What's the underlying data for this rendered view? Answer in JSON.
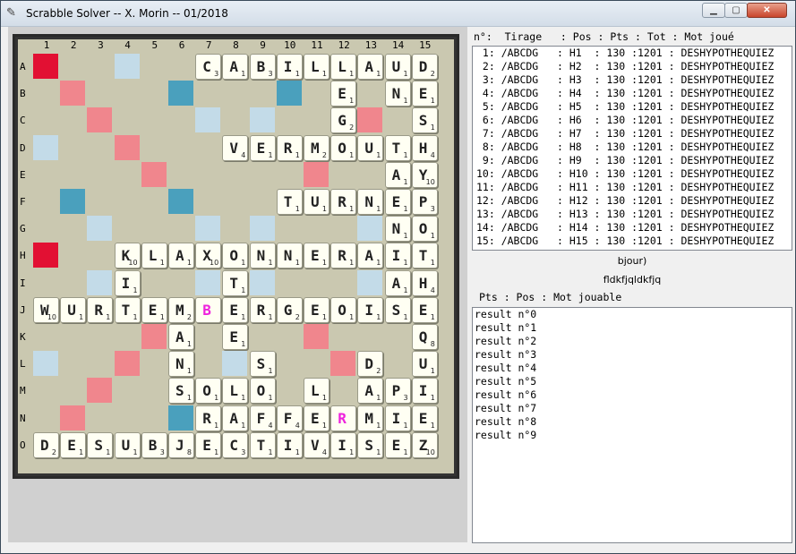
{
  "window": {
    "title": "Scrabble Solver -- X. Morin -- 01/2018"
  },
  "board": {
    "columns": [
      "1",
      "2",
      "3",
      "4",
      "5",
      "6",
      "7",
      "8",
      "9",
      "10",
      "11",
      "12",
      "13",
      "14",
      "15"
    ],
    "rows": [
      "A",
      "B",
      "C",
      "D",
      "E",
      "F",
      "G",
      "H",
      "I",
      "J",
      "K",
      "L",
      "M",
      "N",
      "O"
    ],
    "premium_map": [
      "T..d...........",
      ".d...l...l.....",
      "..d...d.d...d..",
      "d..d...........",
      "....d.....d....",
      ".l...l.........",
      "..d...d.d...d..",
      "T..............",
      "..d...d.d...d..",
      "...............",
      "....d.....d....",
      "d..d...d...d...",
      "..d...d.d...d..",
      ".d...l.........",
      "..............."
    ],
    "tiles": [
      [
        "A",
        7,
        "C",
        "3"
      ],
      [
        "A",
        8,
        "A",
        "1"
      ],
      [
        "A",
        9,
        "B",
        "3"
      ],
      [
        "A",
        10,
        "I",
        "1"
      ],
      [
        "A",
        11,
        "L",
        "1"
      ],
      [
        "A",
        12,
        "L",
        "1"
      ],
      [
        "A",
        13,
        "A",
        "1"
      ],
      [
        "A",
        14,
        "U",
        "1"
      ],
      [
        "A",
        15,
        "D",
        "2"
      ],
      [
        "B",
        12,
        "E",
        "1"
      ],
      [
        "B",
        14,
        "N",
        "1"
      ],
      [
        "B",
        15,
        "E",
        "1"
      ],
      [
        "C",
        12,
        "G",
        "2"
      ],
      [
        "C",
        15,
        "S",
        "1"
      ],
      [
        "D",
        8,
        "V",
        "4"
      ],
      [
        "D",
        9,
        "E",
        "1"
      ],
      [
        "D",
        10,
        "R",
        "1"
      ],
      [
        "D",
        11,
        "M",
        "2"
      ],
      [
        "D",
        12,
        "O",
        "1"
      ],
      [
        "D",
        13,
        "U",
        "1"
      ],
      [
        "D",
        14,
        "T",
        "1"
      ],
      [
        "D",
        15,
        "H",
        "4"
      ],
      [
        "E",
        14,
        "A",
        "1"
      ],
      [
        "E",
        15,
        "Y",
        "10"
      ],
      [
        "F",
        10,
        "T",
        "1"
      ],
      [
        "F",
        11,
        "U",
        "1"
      ],
      [
        "F",
        12,
        "R",
        "1"
      ],
      [
        "F",
        13,
        "N",
        "1"
      ],
      [
        "F",
        14,
        "E",
        "1"
      ],
      [
        "F",
        15,
        "P",
        "3"
      ],
      [
        "G",
        14,
        "N",
        "1"
      ],
      [
        "G",
        15,
        "O",
        "1"
      ],
      [
        "H",
        4,
        "K",
        "10"
      ],
      [
        "H",
        5,
        "L",
        "1"
      ],
      [
        "H",
        6,
        "A",
        "1"
      ],
      [
        "H",
        7,
        "X",
        "10"
      ],
      [
        "H",
        8,
        "O",
        "1"
      ],
      [
        "H",
        9,
        "N",
        "1"
      ],
      [
        "H",
        10,
        "N",
        "1"
      ],
      [
        "H",
        11,
        "E",
        "1"
      ],
      [
        "H",
        12,
        "R",
        "1"
      ],
      [
        "H",
        13,
        "A",
        "1"
      ],
      [
        "H",
        14,
        "I",
        "1"
      ],
      [
        "H",
        15,
        "T",
        "1"
      ],
      [
        "I",
        4,
        "I",
        "1"
      ],
      [
        "I",
        8,
        "T",
        "1"
      ],
      [
        "I",
        14,
        "A",
        "1"
      ],
      [
        "I",
        15,
        "H",
        "4"
      ],
      [
        "J",
        1,
        "W",
        "10"
      ],
      [
        "J",
        2,
        "U",
        "1"
      ],
      [
        "J",
        3,
        "R",
        "1"
      ],
      [
        "J",
        4,
        "T",
        "1"
      ],
      [
        "J",
        5,
        "E",
        "1"
      ],
      [
        "J",
        6,
        "M",
        "2"
      ],
      [
        "J",
        7,
        "B",
        "*"
      ],
      [
        "J",
        8,
        "E",
        "1"
      ],
      [
        "J",
        9,
        "R",
        "1"
      ],
      [
        "J",
        10,
        "G",
        "2"
      ],
      [
        "J",
        11,
        "E",
        "1"
      ],
      [
        "J",
        12,
        "O",
        "1"
      ],
      [
        "J",
        13,
        "I",
        "1"
      ],
      [
        "J",
        14,
        "S",
        "1"
      ],
      [
        "J",
        15,
        "E",
        "1"
      ],
      [
        "K",
        6,
        "A",
        "1"
      ],
      [
        "K",
        8,
        "E",
        "1"
      ],
      [
        "K",
        15,
        "Q",
        "8"
      ],
      [
        "L",
        6,
        "N",
        "1"
      ],
      [
        "L",
        9,
        "S",
        "1"
      ],
      [
        "L",
        13,
        "D",
        "2"
      ],
      [
        "L",
        15,
        "U",
        "1"
      ],
      [
        "M",
        6,
        "S",
        "1"
      ],
      [
        "M",
        7,
        "O",
        "1"
      ],
      [
        "M",
        8,
        "L",
        "1"
      ],
      [
        "M",
        9,
        "O",
        "1"
      ],
      [
        "M",
        11,
        "L",
        "1"
      ],
      [
        "M",
        13,
        "A",
        "1"
      ],
      [
        "M",
        14,
        "P",
        "3"
      ],
      [
        "M",
        15,
        "I",
        "1"
      ],
      [
        "N",
        7,
        "R",
        "1"
      ],
      [
        "N",
        8,
        "A",
        "1"
      ],
      [
        "N",
        9,
        "F",
        "4"
      ],
      [
        "N",
        10,
        "F",
        "4"
      ],
      [
        "N",
        11,
        "E",
        "1"
      ],
      [
        "N",
        12,
        "R",
        "*"
      ],
      [
        "N",
        13,
        "M",
        "1"
      ],
      [
        "N",
        14,
        "I",
        "1"
      ],
      [
        "N",
        15,
        "E",
        "1"
      ],
      [
        "O",
        1,
        "D",
        "2"
      ],
      [
        "O",
        2,
        "E",
        "1"
      ],
      [
        "O",
        3,
        "S",
        "1"
      ],
      [
        "O",
        4,
        "U",
        "1"
      ],
      [
        "O",
        5,
        "B",
        "3"
      ],
      [
        "O",
        6,
        "J",
        "8"
      ],
      [
        "O",
        7,
        "E",
        "1"
      ],
      [
        "O",
        8,
        "C",
        "3"
      ],
      [
        "O",
        9,
        "T",
        "1"
      ],
      [
        "O",
        10,
        "I",
        "1"
      ],
      [
        "O",
        11,
        "V",
        "4"
      ],
      [
        "O",
        12,
        "I",
        "1"
      ],
      [
        "O",
        13,
        "S",
        "1"
      ],
      [
        "O",
        14,
        "E",
        "1"
      ],
      [
        "O",
        15,
        "Z",
        "10"
      ]
    ]
  },
  "plays": {
    "header": "n°:  Tirage   : Pos : Pts : Tot : Mot joué",
    "rows": [
      " 1: /ABCDG   : H1  : 130 :1201 : DESHYPOTHEQUIEZ",
      " 2: /ABCDG   : H2  : 130 :1201 : DESHYPOTHEQUIEZ",
      " 3: /ABCDG   : H3  : 130 :1201 : DESHYPOTHEQUIEZ",
      " 4: /ABCDG   : H4  : 130 :1201 : DESHYPOTHEQUIEZ",
      " 5: /ABCDG   : H5  : 130 :1201 : DESHYPOTHEQUIEZ",
      " 6: /ABCDG   : H6  : 130 :1201 : DESHYPOTHEQUIEZ",
      " 7: /ABCDG   : H7  : 130 :1201 : DESHYPOTHEQUIEZ",
      " 8: /ABCDG   : H8  : 130 :1201 : DESHYPOTHEQUIEZ",
      " 9: /ABCDG   : H9  : 130 :1201 : DESHYPOTHEQUIEZ",
      "10: /ABCDG   : H10 : 130 :1201 : DESHYPOTHEQUIEZ",
      "11: /ABCDG   : H11 : 130 :1201 : DESHYPOTHEQUIEZ",
      "12: /ABCDG   : H12 : 130 :1201 : DESHYPOTHEQUIEZ",
      "13: /ABCDG   : H13 : 130 :1201 : DESHYPOTHEQUIEZ",
      "14: /ABCDG   : H14 : 130 :1201 : DESHYPOTHEQUIEZ",
      "15: /ABCDG   : H15 : 130 :1201 : DESHYPOTHEQUIEZ"
    ]
  },
  "label1": "bjour)",
  "label2": "fldkfjqldkfjq",
  "playable": {
    "header": "Pts : Pos : Mot jouable",
    "rows": [
      "result n°0",
      "result n°1",
      "result n°2",
      "result n°3",
      "result n°4",
      "result n°5",
      "result n°6",
      "result n°7",
      "result n°8",
      "result n°9"
    ]
  },
  "colors": {
    "triple_word": "#e21033",
    "double_word": "#f0868d",
    "triple_letter": "#4aa0bd",
    "double_letter": "#c3dbe8",
    "blank_letter": "#ee22dd"
  }
}
